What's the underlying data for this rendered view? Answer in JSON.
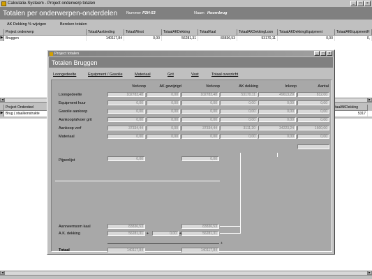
{
  "window": {
    "title": "Calculatie-Systeem - Project onderwerp totalen"
  },
  "header": {
    "title": "Totalen per onderwerpen-onderdelen",
    "nummer_label": "Nummer",
    "nummer_value": "P2H-53",
    "naam_label": "Naam",
    "naam_value": "Hoornbrug"
  },
  "toolbar": {
    "ak_btn": "AK Dekking % wijzigen",
    "calc_btn": "Bereken totalen"
  },
  "grid1": {
    "headers": [
      "Project onderwerp",
      "TotaalAanbieding",
      "TotaalWinst",
      "TotaalAKDekking",
      "TotaalKaal",
      "TotaalAKDekkingLoon",
      "TotaalAKDekkingEquipment",
      "TotaalAKEquipmentH"
    ],
    "row": [
      "Bruggen",
      "140117,84",
      "0,00",
      "56281,31",
      "83836,53",
      "53170,11",
      "0,00",
      "0,"
    ]
  },
  "grid2": {
    "headers": [
      "Project Onderdeel",
      "TotaalAKDekking"
    ],
    "row": [
      "Brug ( staalkonstrukte",
      "5317"
    ]
  },
  "dialog": {
    "title": "Project totalen",
    "header": "Totalen Bruggen",
    "tabs": [
      "Loongedeelte",
      "Equipment / Gasolie",
      "Materiaal",
      "Grit",
      "Vast",
      "Totaal overzicht"
    ],
    "columns": [
      "Verkoop",
      "AK gewijzigd",
      "Verkoop",
      "AK dekking",
      "Inkoop",
      "Aantal"
    ],
    "rows": [
      {
        "label": "Loongedeelte",
        "values": [
          "102783,48",
          "0,00",
          "102783,48",
          "53170,11",
          "49613,29",
          "812,00"
        ]
      },
      {
        "label": "Equipment huur",
        "values": [
          "0,00",
          "0,00",
          "0,00",
          "0,00",
          "0,00",
          "0,00"
        ]
      },
      {
        "label": "Gasolie aankoop",
        "values": [
          "0,00",
          "0,00",
          "0,00",
          "0,00",
          "0,00",
          "0,00"
        ]
      },
      {
        "label": "Aankoop/afvoer grit",
        "values": [
          "0,00",
          "0,00",
          "0,00",
          "0,00",
          "0,00",
          "0,00"
        ]
      },
      {
        "label": "Aankoop verf",
        "values": [
          "37334,44",
          "0,00",
          "37334,44",
          "3111,20",
          "34223,24",
          "1600,00"
        ]
      },
      {
        "label": "Materiaal",
        "values": [
          "0,00",
          "0,00",
          "0,00",
          "0,00",
          "0,00",
          "0,00"
        ]
      }
    ],
    "pijpenlijst": {
      "label": "Pijpenlijst",
      "left": "0,00",
      "right": "0,00"
    },
    "aanneemsom": {
      "label": "Aanneemsom kaal",
      "left": "83836,53",
      "right": "83836,53"
    },
    "ak_dekking": {
      "label": "A.K. dekking",
      "left": "56281,31",
      "mid": "0,00",
      "right": "56281,31"
    },
    "totaal": {
      "label": "Totaal",
      "left": "140117,84",
      "right": "140117,84"
    },
    "ops": {
      "plus": "+"
    }
  },
  "colors": {
    "header_bg": "#808080",
    "panel_bg": "#a8a8a8",
    "field_bg": "#d8d8d8"
  }
}
